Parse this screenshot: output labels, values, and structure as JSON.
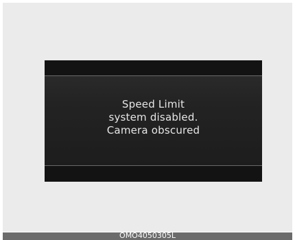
{
  "display": {
    "message_lines": [
      "Speed Limit",
      "system disabled.",
      "Camera obscured"
    ]
  },
  "footer": {
    "code": "OMO4050305L"
  },
  "colors": {
    "panel_background": "#ebebeb",
    "screen_background": "#1c1c1c",
    "message_text": "#e6e6e6",
    "footer_bar": "#6b6b6b"
  }
}
